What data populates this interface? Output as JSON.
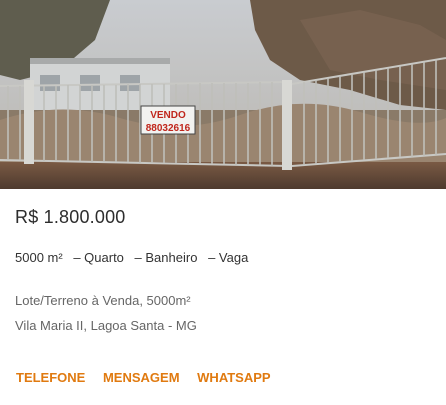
{
  "listing": {
    "photo": {
      "alt": "",
      "sign_title": "VENDO",
      "sign_phone": "88032616"
    },
    "price": "R$ 1.800.000",
    "features": {
      "area": "5000 m²",
      "quarto": "– Quarto",
      "banheiro": "– Banheiro",
      "vaga": "– Vaga"
    },
    "description": "Lote/Terreno à Venda, 5000m²",
    "address": "Vila Maria II, Lagoa Santa - MG",
    "actions": {
      "telefone": "TELEFONE",
      "mensagem": "MENSAGEM",
      "whatsapp": "WHATSAPP"
    },
    "colors": {
      "accent": "#e07a10",
      "price_text": "#2d2d2d",
      "muted_text": "#666666"
    }
  }
}
